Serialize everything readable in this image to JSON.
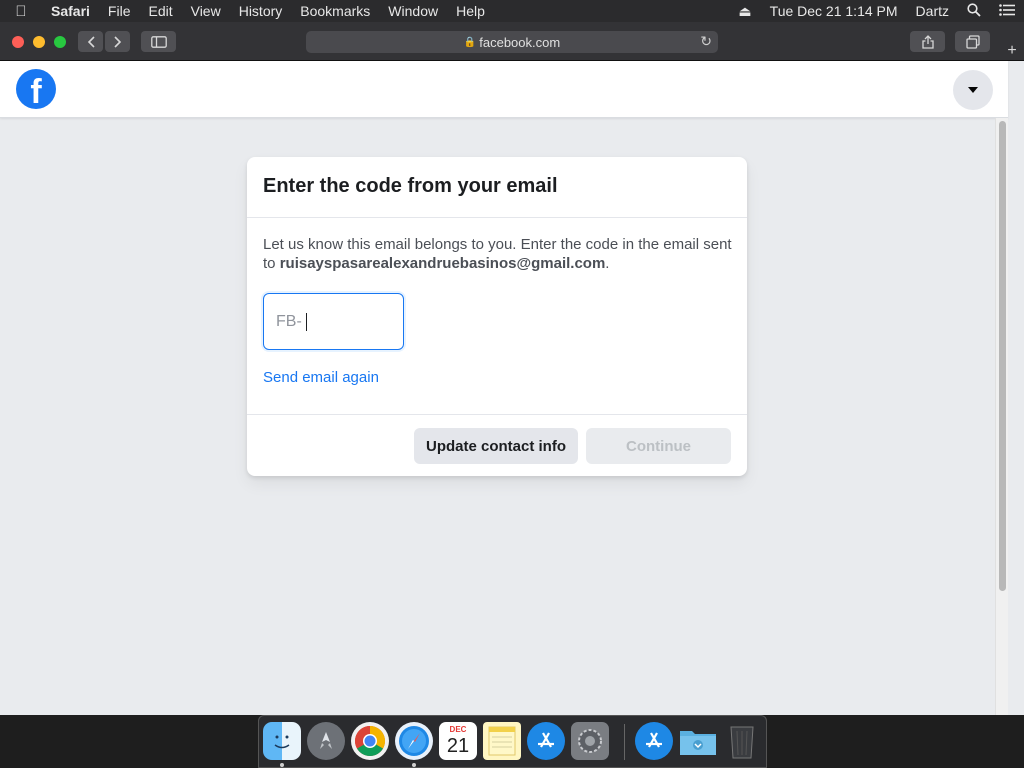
{
  "menubar": {
    "app": "Safari",
    "items": [
      "File",
      "Edit",
      "View",
      "History",
      "Bookmarks",
      "Window",
      "Help"
    ],
    "clock": "Tue Dec 21  1:14 PM",
    "user": "Dartz"
  },
  "browser": {
    "url": "facebook.com"
  },
  "page": {
    "logo": "f",
    "title": "Enter the code from your email",
    "desc_prefix": "Let us know this email belongs to you. Enter the code in the email sent to ",
    "email": "ruisayspasarealexandruebasinos@gmail.com",
    "desc_suffix": ".",
    "code_prefix": "FB-",
    "resend_label": "Send email again",
    "update_label": "Update contact info",
    "continue_label": "Continue"
  },
  "dock": {
    "calendar_month": "DEC",
    "calendar_day": "21",
    "apps": [
      "finder",
      "launchpad",
      "chrome",
      "safari",
      "calendar",
      "notes",
      "app-store",
      "system-preferences",
      "app-store",
      "downloads",
      "trash"
    ]
  },
  "colors": {
    "fb_blue": "#1877f2",
    "page_bg": "#e9ebee",
    "menubar_bg": "#2b2b2d"
  }
}
